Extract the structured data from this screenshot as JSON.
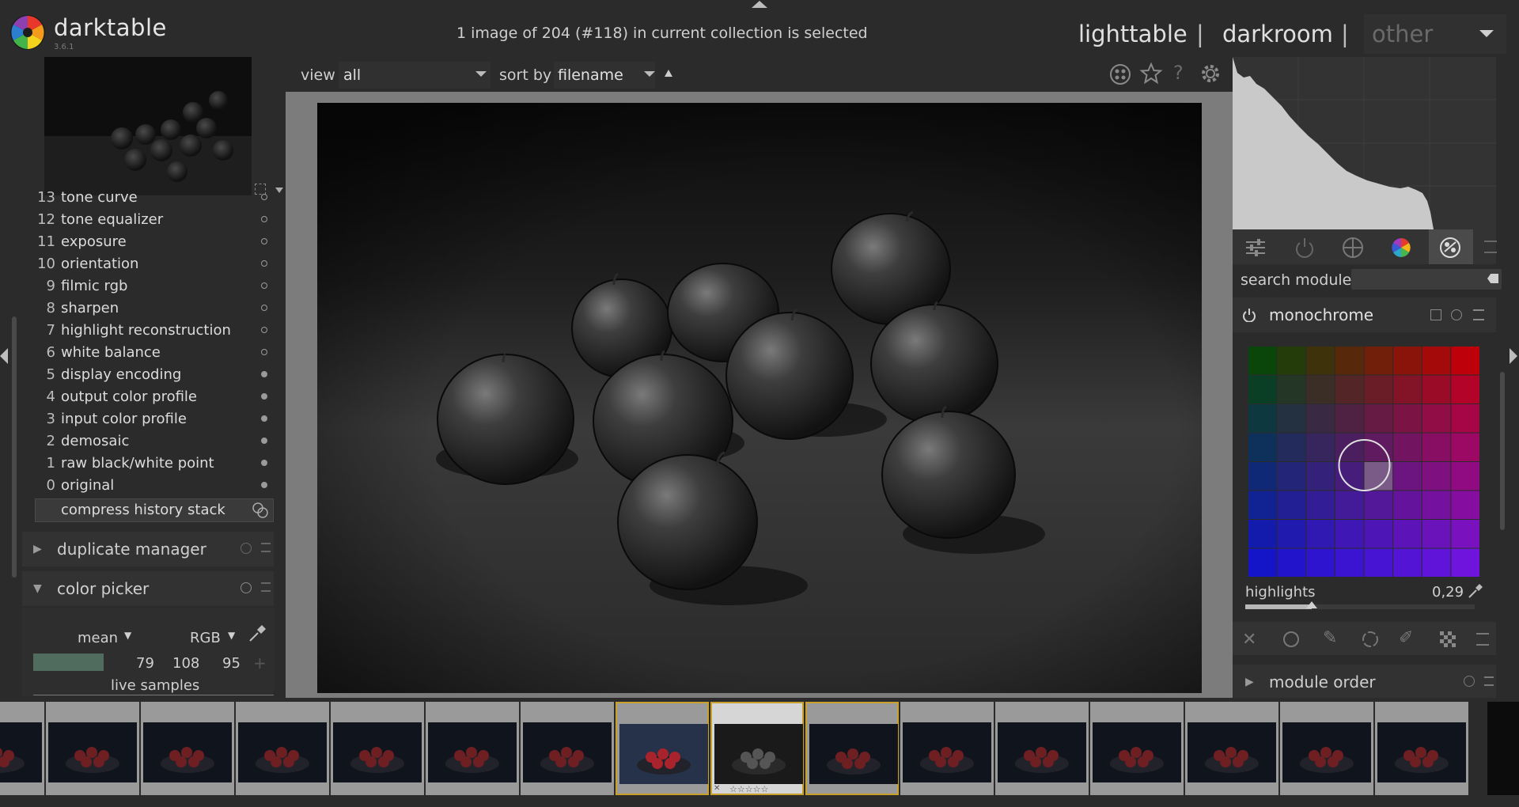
{
  "app": {
    "name": "darktable",
    "version": "3.6.1",
    "status": "1 image of 204 (#118) in current collection is selected"
  },
  "views": {
    "lighttable": "lighttable",
    "sep1": "|",
    "darkroom": "darkroom",
    "sep2": "|",
    "other": "other"
  },
  "toolbar": {
    "view_label": "view",
    "view_value": "all",
    "sort_label": "sort by",
    "sort_value": "filename"
  },
  "history": [
    {
      "num": "13",
      "name": "tone curve",
      "on": false
    },
    {
      "num": "12",
      "name": "tone equalizer",
      "on": false
    },
    {
      "num": "11",
      "name": "exposure",
      "on": false
    },
    {
      "num": "10",
      "name": "orientation",
      "on": false
    },
    {
      "num": "9",
      "name": "filmic rgb",
      "on": false
    },
    {
      "num": "8",
      "name": "sharpen",
      "on": false
    },
    {
      "num": "7",
      "name": "highlight reconstruction",
      "on": false
    },
    {
      "num": "6",
      "name": "white balance",
      "on": false
    },
    {
      "num": "5",
      "name": "display encoding",
      "on": true
    },
    {
      "num": "4",
      "name": "output color profile",
      "on": true
    },
    {
      "num": "3",
      "name": "input color profile",
      "on": true
    },
    {
      "num": "2",
      "name": "demosaic",
      "on": true
    },
    {
      "num": "1",
      "name": "raw black/white point",
      "on": true
    },
    {
      "num": "0",
      "name": "original",
      "on": true
    }
  ],
  "compress_label": "compress history stack",
  "modules_left": {
    "duplicate_manager": "duplicate manager",
    "color_picker": "color picker"
  },
  "color_picker": {
    "mode": "mean",
    "space": "RGB",
    "swatch_color": "#4f6c5f",
    "values": [
      "79",
      "108",
      "95"
    ],
    "live_samples": "live samples"
  },
  "right": {
    "search_label": "search module",
    "module_title": "monochrome",
    "slider_label": "highlights",
    "slider_value": "0,29",
    "slider_fraction": 0.29,
    "module_order": "module order"
  },
  "filmstrip": {
    "count": 16,
    "current_index": 8,
    "selected_indices": [
      7,
      8,
      9
    ]
  }
}
